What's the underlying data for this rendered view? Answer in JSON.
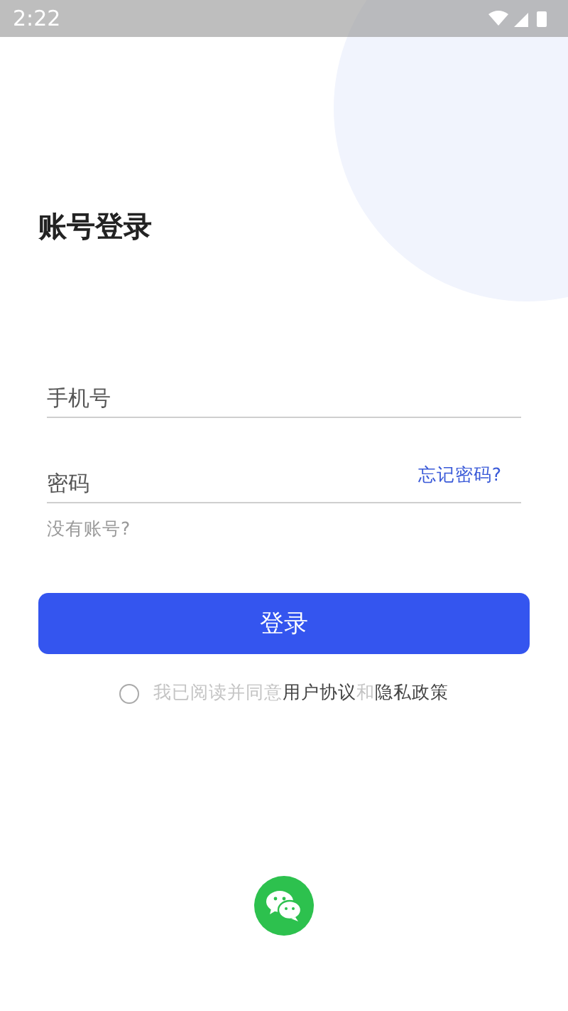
{
  "status_bar": {
    "time": "2:22"
  },
  "title": "账号登录",
  "phone_field": {
    "placeholder": "手机号"
  },
  "password_field": {
    "placeholder": "密码"
  },
  "forgot_link": "忘记密码?",
  "register_link": "没有账号?",
  "login_button": "登录",
  "agreement": {
    "checked": false,
    "parts": [
      {
        "kind": "plain",
        "text": "我已阅读并同意"
      },
      {
        "kind": "link",
        "text": "用户协议"
      },
      {
        "kind": "plain",
        "text": "和"
      },
      {
        "kind": "link",
        "text": "隐私政策"
      }
    ]
  }
}
